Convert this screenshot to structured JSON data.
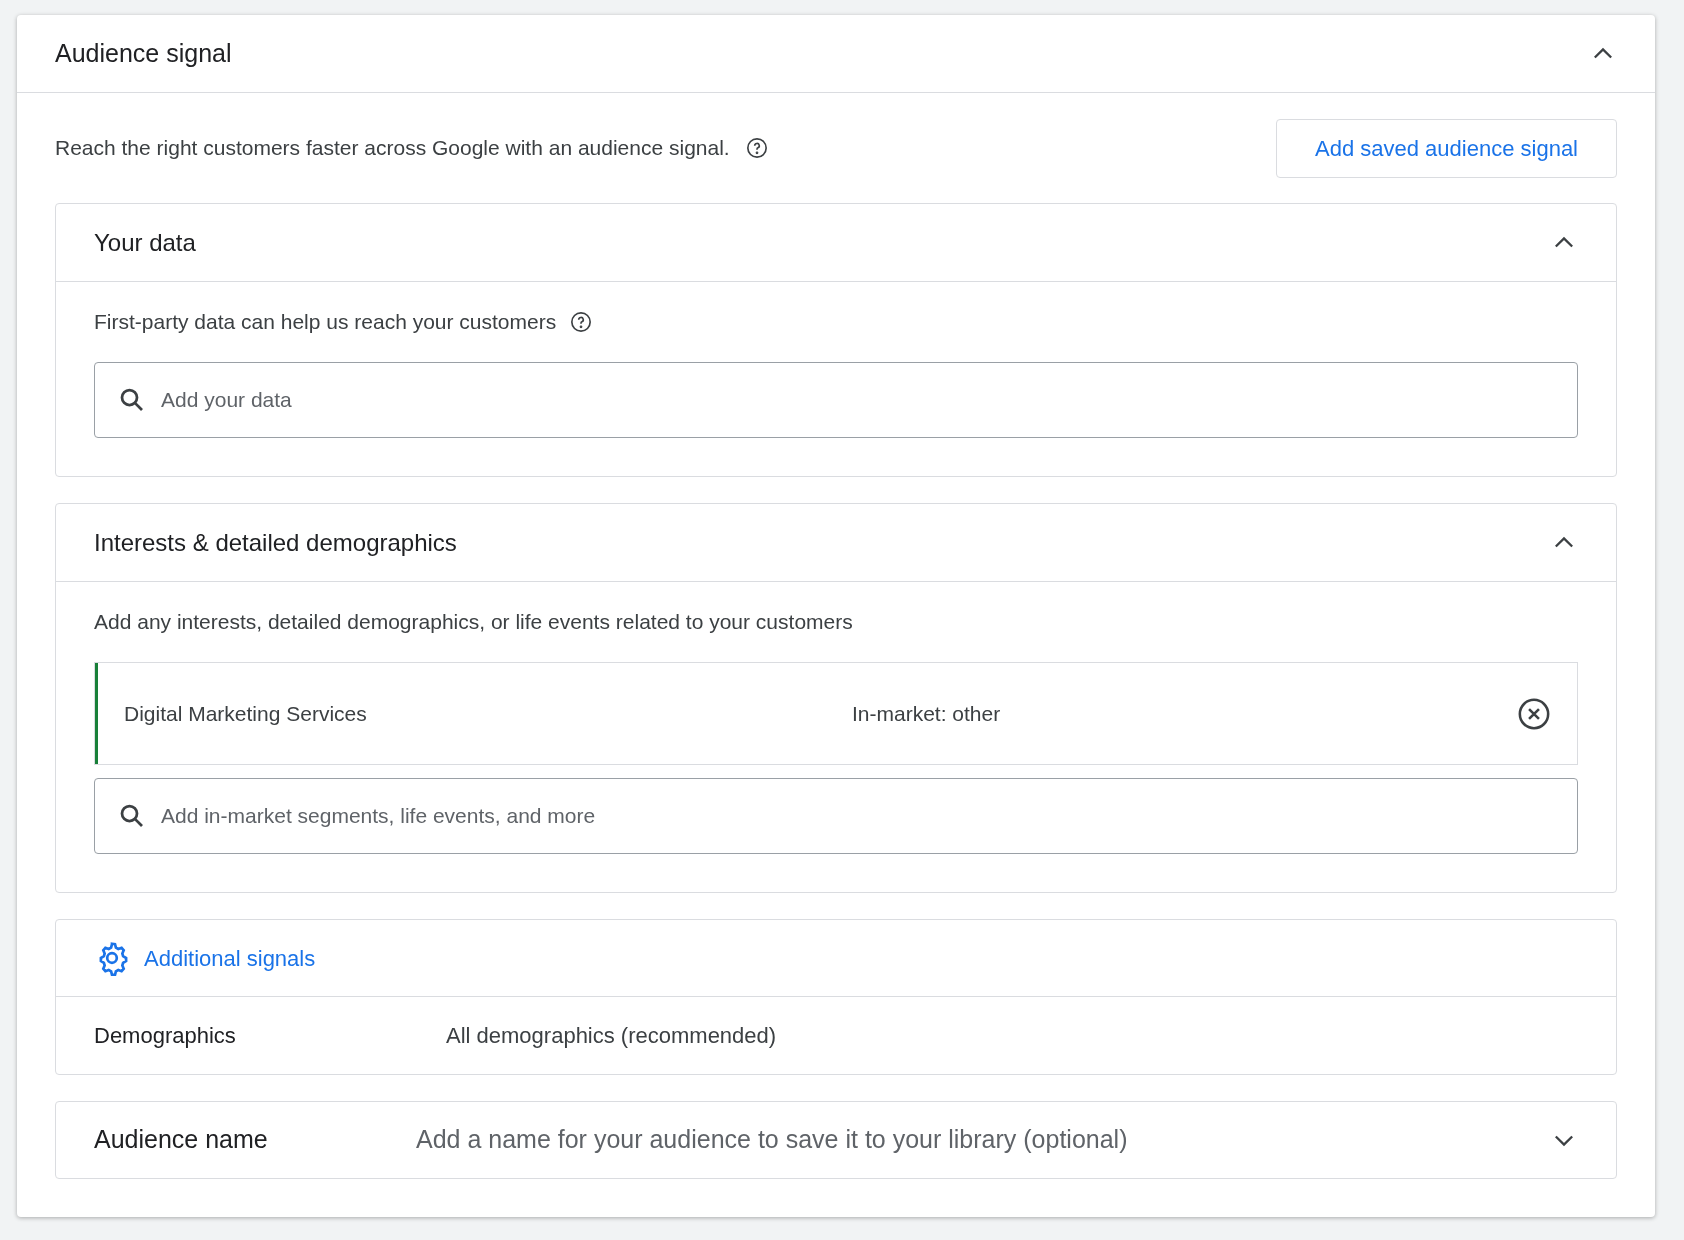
{
  "panel": {
    "title": "Audience signal",
    "expanded": true
  },
  "intro": {
    "text": "Reach the right customers faster across Google with an audience signal.",
    "button": "Add saved audience signal"
  },
  "sections": [
    {
      "title": "Your data",
      "expanded": true,
      "description": "First-party data can help us reach your customers",
      "help": true,
      "search": {
        "placeholder": "Add your data"
      }
    },
    {
      "title": "Interests & detailed demographics",
      "expanded": true,
      "description": "Add any interests, detailed demographics, or life events related to your customers",
      "help": false,
      "items": [
        {
          "name": "Digital Marketing Services",
          "type": "In-market: other",
          "color": "#188038"
        }
      ],
      "search": {
        "placeholder": "Add in-market segments, life events, and more"
      }
    }
  ],
  "additional_signals": {
    "link": "Additional signals",
    "rows": [
      {
        "label": "Demographics",
        "value": "All demographics (recommended)"
      }
    ]
  },
  "audience_name": {
    "label": "Audience name",
    "placeholder": "Add a name for your audience to save it to your library (optional)",
    "expanded": false
  }
}
